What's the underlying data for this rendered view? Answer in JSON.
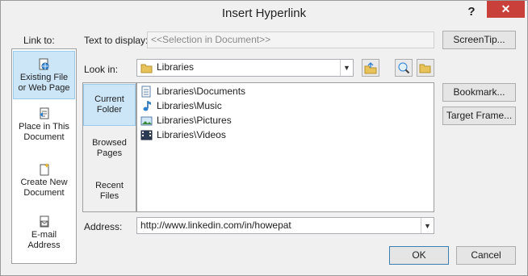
{
  "window": {
    "title": "Insert Hyperlink",
    "help_glyph": "?",
    "close_glyph": "✕"
  },
  "link_to": {
    "label": "Link to:",
    "items": [
      {
        "line1": "Existing File",
        "line2": "or Web Page",
        "icon": "globe-file-icon",
        "selected": true
      },
      {
        "line1": "Place in This",
        "line2": "Document",
        "icon": "document-place-icon",
        "selected": false
      },
      {
        "line1": "Create New",
        "line2": "Document",
        "icon": "new-document-icon",
        "selected": false
      },
      {
        "line1": "E-mail",
        "line2": "Address",
        "icon": "email-icon",
        "selected": false
      }
    ]
  },
  "text_to_display": {
    "label": "Text to display:",
    "value": "<<Selection in Document>>"
  },
  "screentip": {
    "label": "ScreenTip..."
  },
  "look_in": {
    "label": "Look in:",
    "value": "Libraries"
  },
  "subtabs": [
    {
      "line1": "Current",
      "line2": "Folder",
      "selected": true
    },
    {
      "line1": "Browsed",
      "line2": "Pages",
      "selected": false
    },
    {
      "line1": "Recent",
      "line2": "Files",
      "selected": false
    }
  ],
  "files": [
    {
      "name": "Libraries\\Documents",
      "icon": "documents-library-icon"
    },
    {
      "name": "Libraries\\Music",
      "icon": "music-library-icon"
    },
    {
      "name": "Libraries\\Pictures",
      "icon": "pictures-library-icon"
    },
    {
      "name": "Libraries\\Videos",
      "icon": "videos-library-icon"
    }
  ],
  "bookmark": {
    "label": "Bookmark..."
  },
  "target_frame": {
    "label": "Target Frame..."
  },
  "address": {
    "label": "Address:",
    "value": "http://www.linkedin.com/in/howepat"
  },
  "ok": {
    "label": "OK"
  },
  "cancel": {
    "label": "Cancel"
  },
  "colors": {
    "selection": "#cde6f7",
    "close": "#c9403a"
  }
}
